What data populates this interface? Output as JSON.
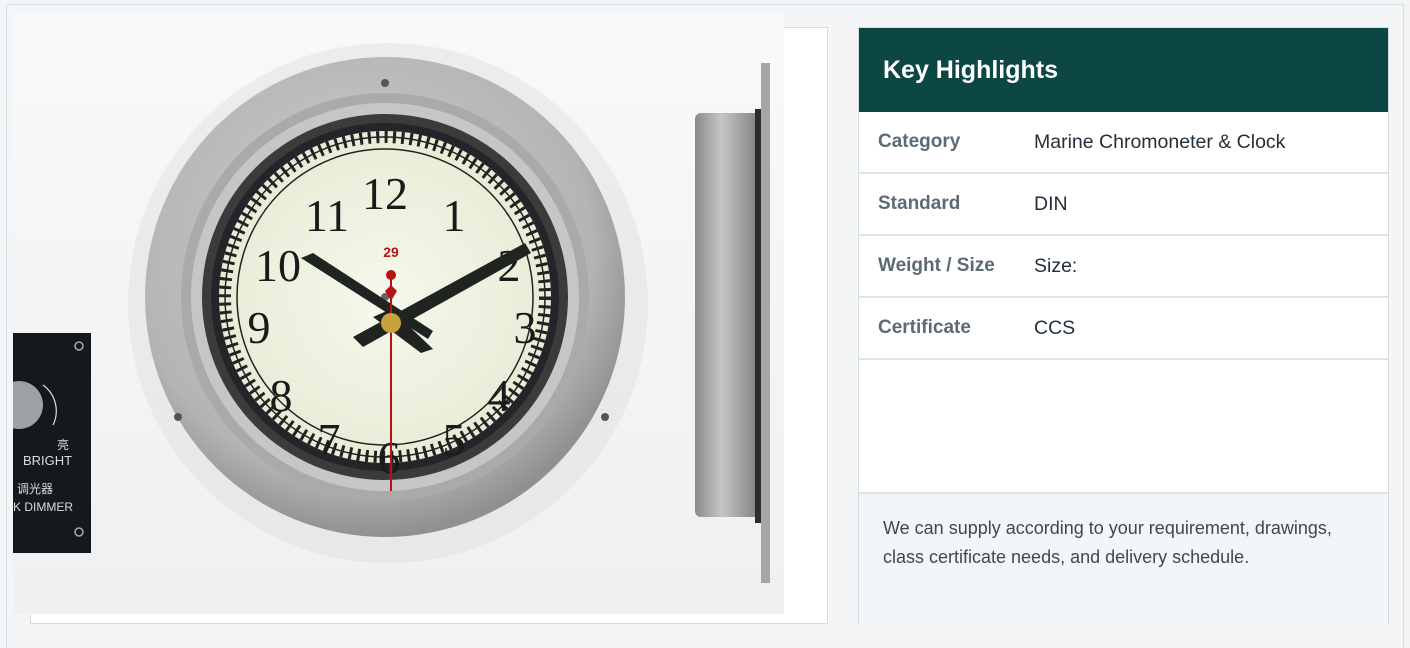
{
  "product_image": {
    "numerals": [
      "12",
      "1",
      "2",
      "3",
      "4",
      "5",
      "6",
      "7",
      "8",
      "9",
      "10",
      "11"
    ],
    "dimmer_labels": [
      "亮",
      "BRIGHT",
      "调光器",
      "K DIMMER"
    ],
    "dial_logo": "29",
    "colors": {
      "bezel": "#b8b9bb",
      "dial": "#f1f4e4",
      "hands": "#1f2420",
      "second_hand": "#b41414",
      "center": "#c8a23a"
    }
  },
  "highlights": {
    "title": "Key Highlights",
    "rows": [
      {
        "label": "Category",
        "value": "Marine Chromoneter & Clock"
      },
      {
        "label": "Standard",
        "value": "DIN"
      },
      {
        "label": "Weight / Size",
        "value": "Size:"
      },
      {
        "label": "Certificate",
        "value": "CCS"
      }
    ],
    "note": "We can supply according to your requirement, drawings, class certificate needs, and delivery schedule."
  },
  "colors": {
    "header_bg": "#0c4744",
    "page_bg": "#f3f5f7",
    "border": "#d6dde1"
  }
}
